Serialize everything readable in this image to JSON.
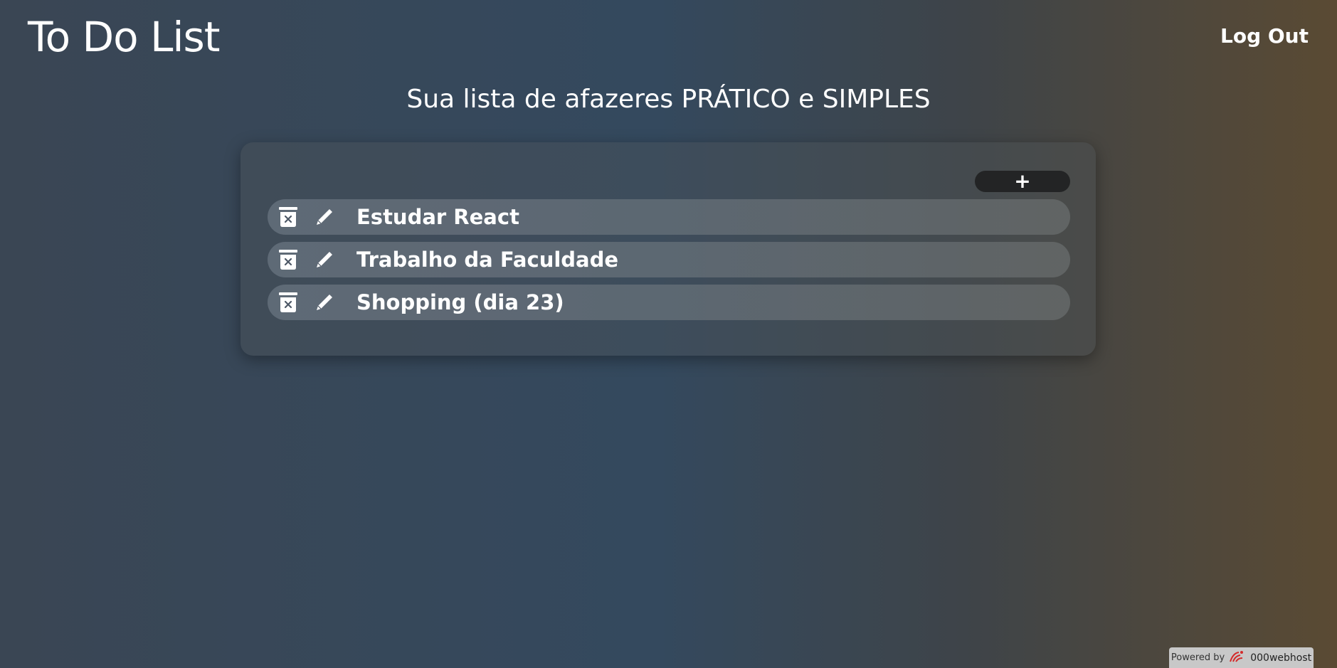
{
  "header": {
    "title": "To Do List",
    "logout_label": "Log Out"
  },
  "main": {
    "subtitle": "Sua lista de afazeres PRÁTICO e SIMPLES",
    "add_button_label": "+",
    "todos": [
      {
        "text": "Estudar React",
        "delete_icon": "trash-icon",
        "edit_icon": "pencil-icon"
      },
      {
        "text": "Trabalho da Faculdade",
        "delete_icon": "trash-icon",
        "edit_icon": "pencil-icon"
      },
      {
        "text": "Shopping (dia 23)",
        "delete_icon": "trash-icon",
        "edit_icon": "pencil-icon"
      }
    ]
  },
  "footer": {
    "powered_by": "Powered by",
    "brand": "000webhost",
    "brand_icon": "000webhost-logo-icon"
  },
  "colors": {
    "text": "#ffffff",
    "add_button_bg": "#232425",
    "gradient_left": "#3a4654",
    "gradient_mid": "#34495e",
    "gradient_right": "#5a4a33",
    "brand_logo": "#d42a2a"
  }
}
